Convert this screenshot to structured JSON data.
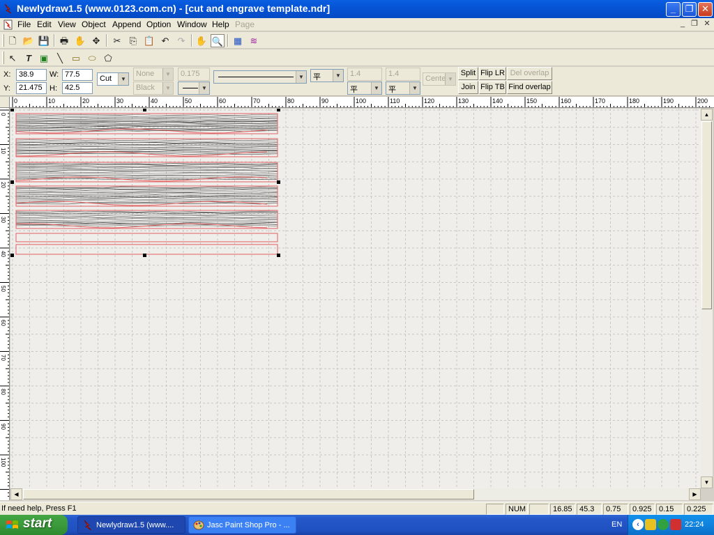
{
  "window": {
    "title": "Newlydraw1.5 (www.0123.com.cn) - [cut and engrave template.ndr]",
    "min_glyph": "_",
    "max_glyph": "❐",
    "close_glyph": "✕"
  },
  "menu": {
    "items": [
      "File",
      "Edit",
      "View",
      "Object",
      "Append",
      "Option",
      "Window",
      "Help",
      "Page"
    ],
    "mdi_min": "_",
    "mdi_restore": "❐",
    "mdi_close": "✕"
  },
  "toolbar1": {
    "buttons": [
      {
        "name": "new-file-icon",
        "glyph": "🗋"
      },
      {
        "name": "open-folder-icon",
        "glyph": "📂"
      },
      {
        "name": "save-icon",
        "glyph": "💾"
      },
      {
        "name": "print-icon",
        "glyph": "🖶"
      },
      {
        "name": "print-preview-icon",
        "glyph": "✋"
      },
      {
        "name": "move-icon",
        "glyph": "✥"
      },
      {
        "name": "cut-icon",
        "glyph": "✂"
      },
      {
        "name": "copy-icon",
        "glyph": "⎘"
      },
      {
        "name": "paste-icon",
        "glyph": "📋"
      },
      {
        "name": "undo-icon",
        "glyph": "↶"
      },
      {
        "name": "redo-icon",
        "glyph": "↷"
      },
      {
        "name": "hand-pan-icon",
        "glyph": "✋"
      },
      {
        "name": "zoom-icon",
        "glyph": "🔍"
      },
      {
        "name": "layers-icon",
        "glyph": "▦"
      },
      {
        "name": "curves-icon",
        "glyph": "≋"
      }
    ]
  },
  "toolbar2": {
    "buttons": [
      {
        "name": "select-arrow-icon",
        "glyph": "↖"
      },
      {
        "name": "text-tool-icon",
        "glyph": "T"
      },
      {
        "name": "image-tool-icon",
        "glyph": "▣"
      },
      {
        "name": "line-tool-icon",
        "glyph": "╲"
      },
      {
        "name": "rectangle-tool-icon",
        "glyph": "▭"
      },
      {
        "name": "ellipse-tool-icon",
        "glyph": "⬭"
      },
      {
        "name": "polygon-tool-icon",
        "glyph": "⬠"
      }
    ]
  },
  "props": {
    "x_label": "X:",
    "x_value": "38.9",
    "y_label": "Y:",
    "y_value": "21.475",
    "w_label": "W:",
    "w_value": "77.5",
    "h_label": "H:",
    "h_value": "42.5",
    "mode": "Cut",
    "fill": "None",
    "color": "Black",
    "width": "0.175",
    "val1": "1.4",
    "val2": "1.4",
    "align": "Cente",
    "buttons": {
      "split": "Split",
      "join": "Join",
      "flip_lr": "Flip LR",
      "flip_tb": "Flip TB",
      "del_overlap": "Del overlap",
      "find_overlap": "Find overlap"
    }
  },
  "ruler": {
    "top_labels": [
      "0",
      "10",
      "20",
      "30",
      "40",
      "50",
      "60",
      "70",
      "80",
      "90",
      "100",
      "110",
      "120",
      "130",
      "140",
      "150",
      "160",
      "170",
      "180",
      "190",
      "200"
    ],
    "left_labels": [
      "0",
      "10",
      "20",
      "30",
      "40",
      "50",
      "60",
      "70",
      "80",
      "90",
      "100"
    ]
  },
  "canvas": {
    "cut_color": "#e06060",
    "grid_color": "#c8c6c2",
    "background": "#f0eeeb"
  },
  "status": {
    "help": "If need help, Press F1",
    "num": "NUM",
    "v1": "16.85",
    "v2": "45.3",
    "v3": "0.75",
    "v4": "0.925",
    "v5": "0.15",
    "v6": "0.225"
  },
  "taskbar": {
    "start": "start",
    "tasks": [
      "Newlydraw1.5 (www....",
      "Jasc Paint Shop Pro - ..."
    ],
    "lang": "EN",
    "clock": "22:24"
  }
}
